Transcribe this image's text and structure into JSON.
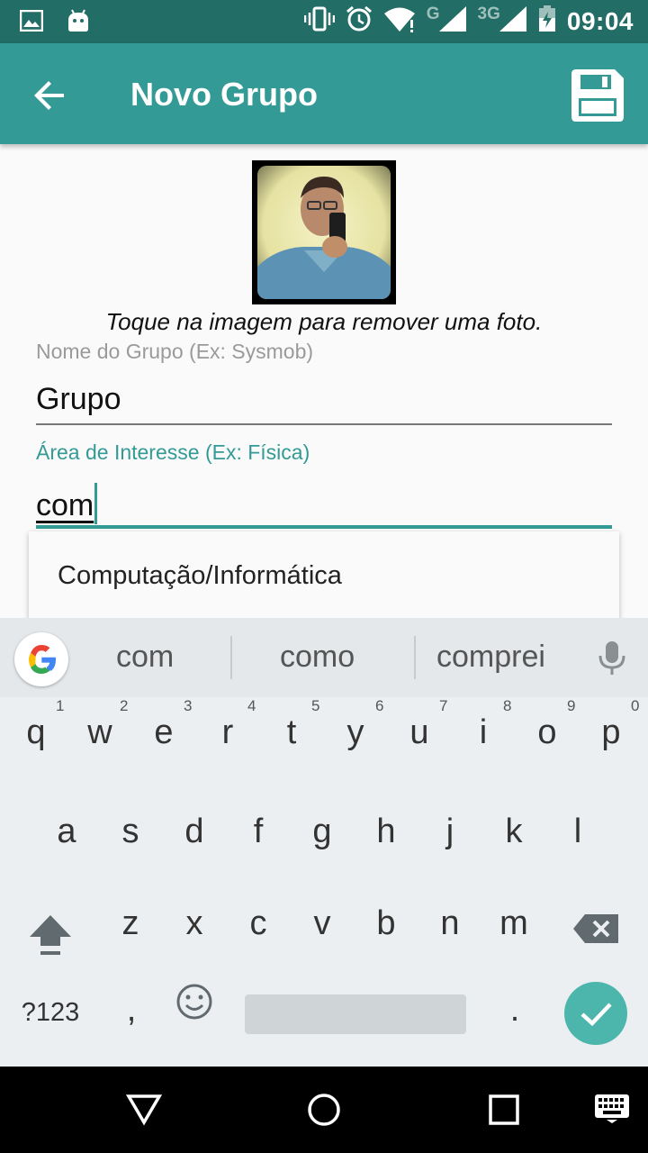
{
  "status_bar": {
    "time": "09:04",
    "network_g": "G",
    "network_3g": "3G"
  },
  "app_bar": {
    "title": "Novo Grupo",
    "back_icon": "arrow-back-icon",
    "save_icon": "floppy-disk-icon"
  },
  "photo": {
    "hint": "Toque na imagem para remover uma foto."
  },
  "form": {
    "name_label": "Nome do Grupo (Ex: Sysmob)",
    "name_value": "Grupo",
    "area_label": "Área de Interesse (Ex: Física)",
    "area_value": "com",
    "accent_color": "#339a96"
  },
  "autocomplete": {
    "items": [
      "Computação/Informática"
    ]
  },
  "keyboard": {
    "suggestions": [
      "com",
      "como",
      "comprei"
    ],
    "row1": [
      "q",
      "w",
      "e",
      "r",
      "t",
      "y",
      "u",
      "i",
      "o",
      "p"
    ],
    "row1_numbers": [
      "1",
      "2",
      "3",
      "4",
      "5",
      "6",
      "7",
      "8",
      "9",
      "0"
    ],
    "row2": [
      "a",
      "s",
      "d",
      "f",
      "g",
      "h",
      "j",
      "k",
      "l"
    ],
    "row3": [
      "z",
      "x",
      "c",
      "v",
      "b",
      "n",
      "m"
    ],
    "symbols_label": "?123",
    "comma": ",",
    "period": "."
  }
}
